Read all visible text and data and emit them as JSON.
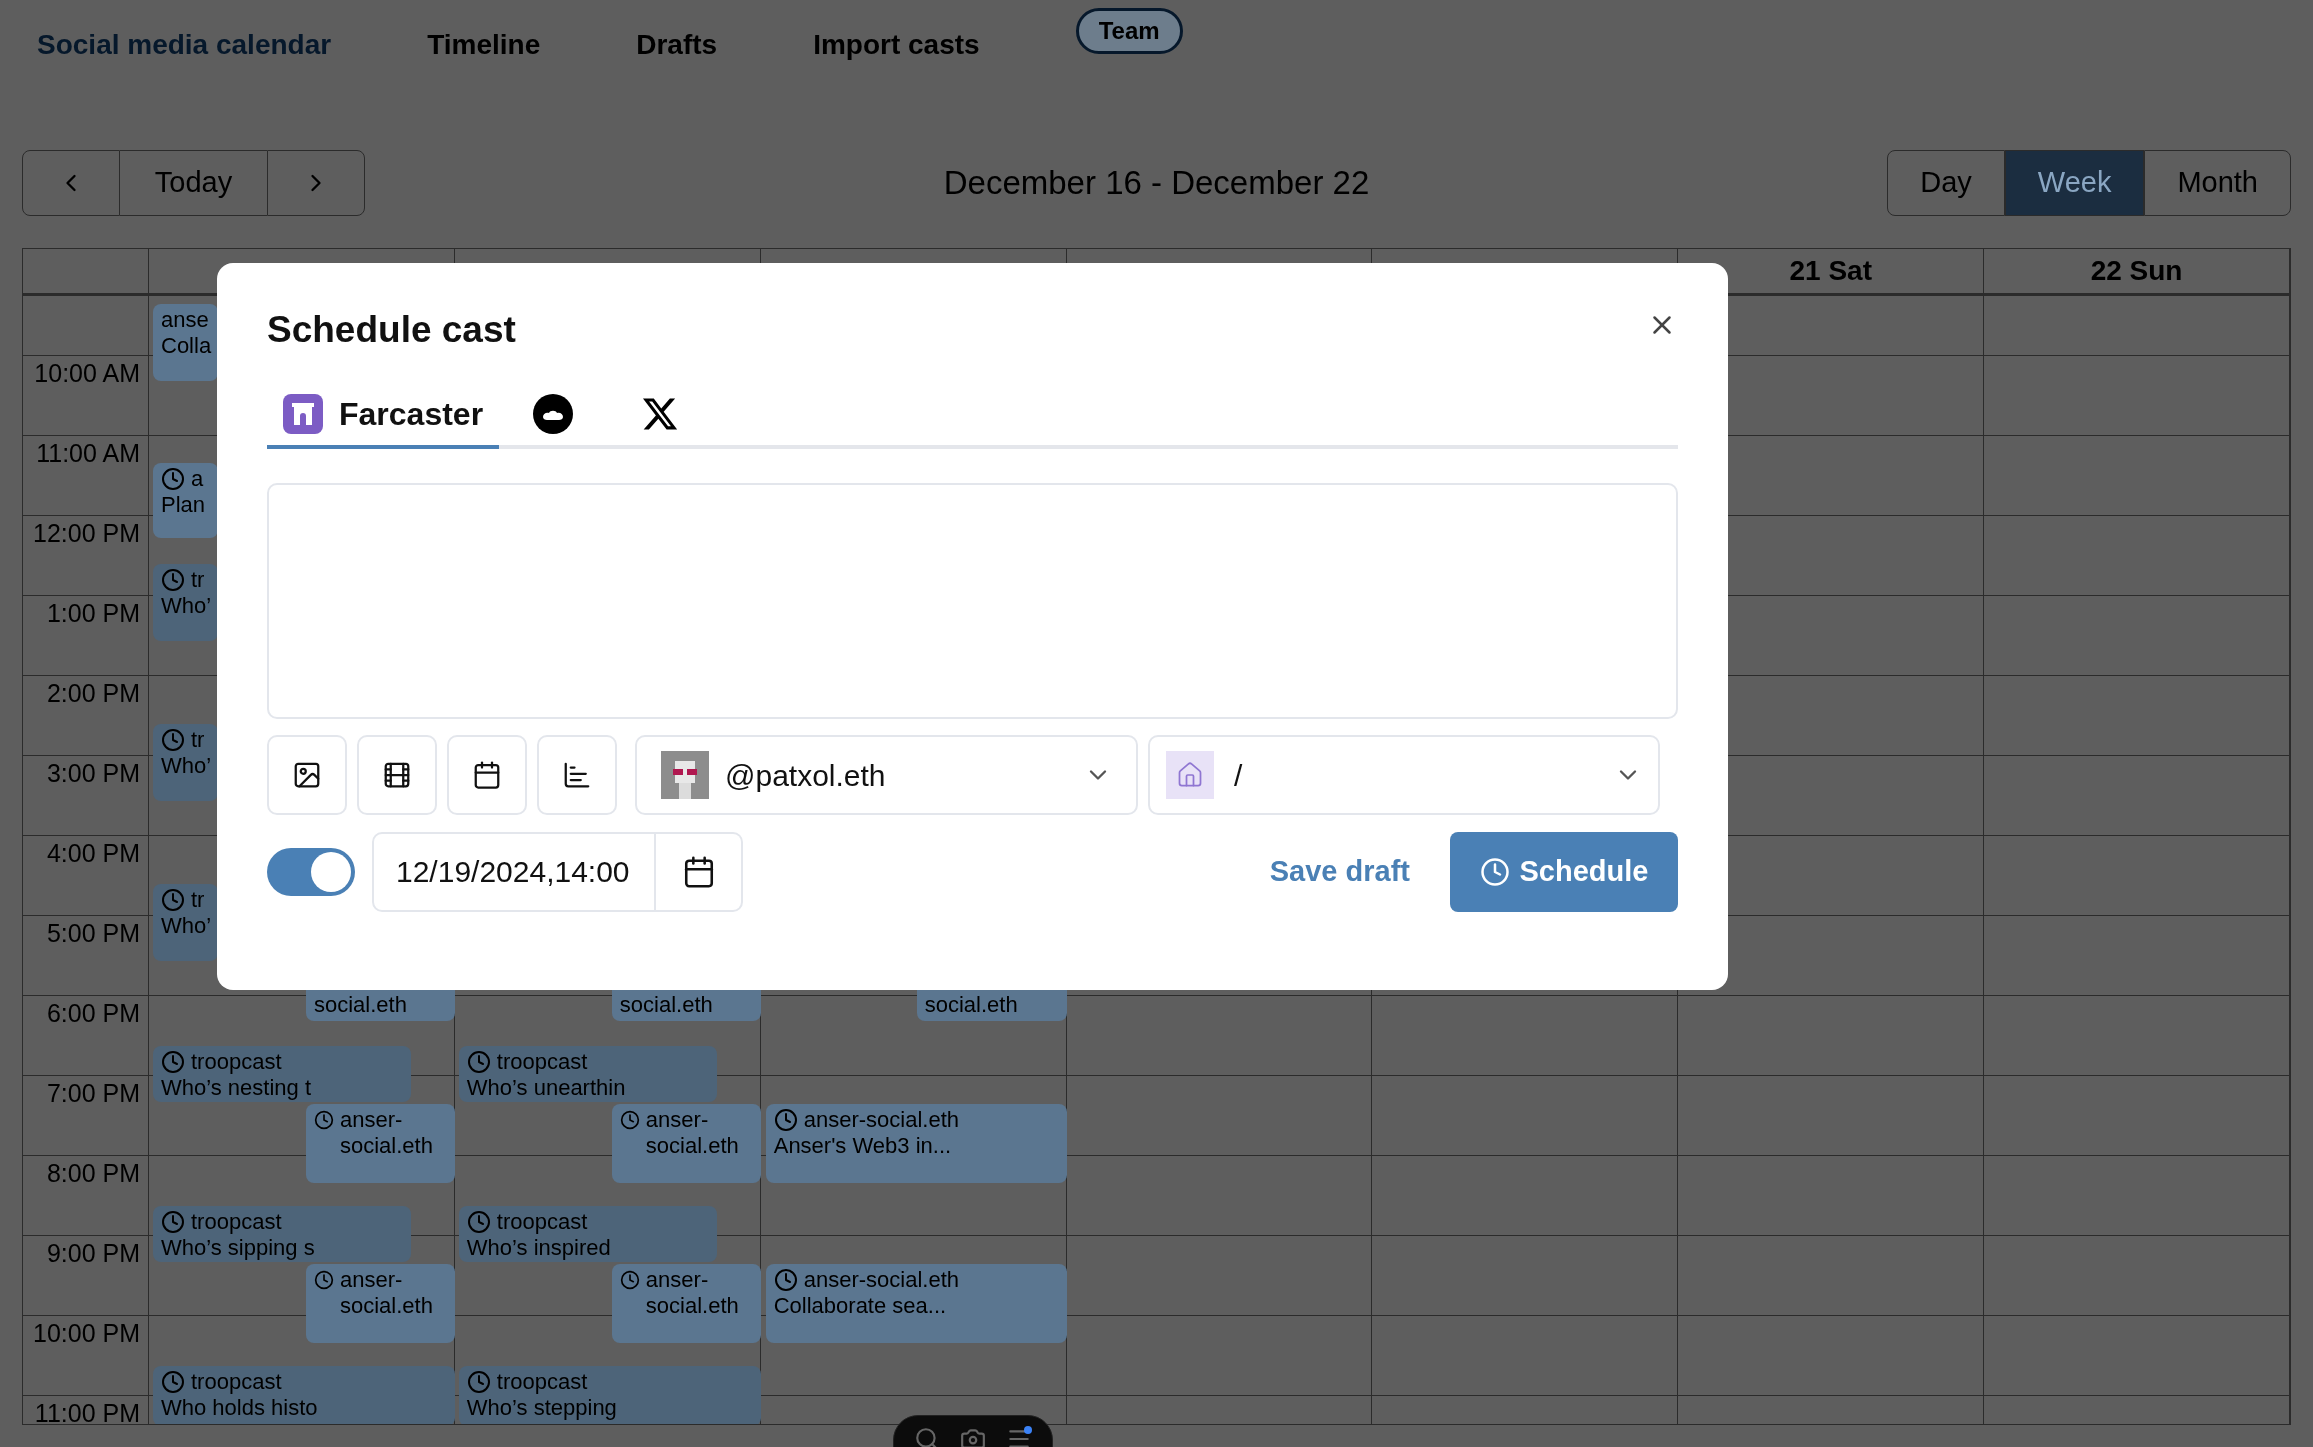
{
  "nav": {
    "items": [
      {
        "label": "Social media calendar",
        "selected": true
      },
      {
        "label": "Timeline",
        "selected": false
      },
      {
        "label": "Drafts",
        "selected": false
      },
      {
        "label": "Import casts",
        "selected": false
      }
    ],
    "badge": "Team"
  },
  "toolbar": {
    "today": "Today",
    "range": "December 16 - December 22",
    "views": [
      {
        "label": "Day",
        "selected": false
      },
      {
        "label": "Week",
        "selected": true
      },
      {
        "label": "Month",
        "selected": false
      }
    ]
  },
  "calendar": {
    "times": [
      "10:00 AM",
      "11:00 AM",
      "12:00 PM",
      "1:00 PM",
      "2:00 PM",
      "3:00 PM",
      "4:00 PM",
      "5:00 PM",
      "6:00 PM",
      "7:00 PM",
      "8:00 PM",
      "9:00 PM",
      "10:00 PM",
      "11:00 PM"
    ],
    "columns": [
      {
        "events": [
          {
            "kind": "muted",
            "icon": false,
            "lines": [
              "anse",
              "Colla"
            ]
          },
          {
            "kind": "muted",
            "icon": true,
            "lines": [
              "a",
              "Plan"
            ]
          },
          {
            "kind": "solid",
            "icon": true,
            "lines": [
              "tr",
              "Who’"
            ]
          },
          {
            "kind": "solid",
            "icon": true,
            "lines": [
              "tr",
              "Who’"
            ]
          },
          {
            "kind": "solid",
            "icon": true,
            "lines": [
              "tr",
              "Who’"
            ]
          },
          {
            "kind": "muted",
            "icon": false,
            "lines": [
              "social.eth"
            ]
          },
          {
            "kind": "solid",
            "icon": true,
            "lines": [
              "troopcast",
              "Who’s nesting t"
            ]
          },
          {
            "kind": "muted",
            "icon": true,
            "lines": [
              "anser-",
              "social.eth"
            ]
          },
          {
            "kind": "solid",
            "icon": true,
            "lines": [
              "troopcast",
              "Who’s sipping s"
            ]
          },
          {
            "kind": "muted",
            "icon": true,
            "lines": [
              "anser-",
              "social.eth"
            ]
          },
          {
            "kind": "solid",
            "icon": true,
            "lines": [
              "troopcast",
              "Who holds histo"
            ]
          }
        ]
      },
      {
        "events": [
          {
            "kind": "muted",
            "icon": false,
            "lines": [
              "social.eth"
            ]
          },
          {
            "kind": "solid",
            "icon": true,
            "lines": [
              "troopcast",
              "Who’s unearthin"
            ]
          },
          {
            "kind": "muted",
            "icon": true,
            "lines": [
              "anser-",
              "social.eth"
            ]
          },
          {
            "kind": "solid",
            "icon": true,
            "lines": [
              "troopcast",
              "Who’s inspired"
            ]
          },
          {
            "kind": "muted",
            "icon": true,
            "lines": [
              "anser-",
              "social.eth"
            ]
          },
          {
            "kind": "solid",
            "icon": true,
            "lines": [
              "troopcast",
              "Who’s stepping"
            ]
          }
        ]
      },
      {
        "events": [
          {
            "kind": "muted",
            "icon": false,
            "lines": [
              "social.eth"
            ]
          },
          {
            "kind": "muted",
            "icon": true,
            "lines": [
              "anser-social.eth",
              "Anser's Web3 in..."
            ]
          },
          {
            "kind": "muted",
            "icon": true,
            "lines": [
              "anser-social.eth",
              "Collaborate sea..."
            ]
          }
        ]
      },
      {},
      {},
      {
        "header": "21 Sat"
      },
      {
        "header": "22 Sun"
      }
    ]
  },
  "dialog": {
    "title": "Schedule cast",
    "tabs": [
      {
        "kind": "farcaster",
        "label": "Farcaster",
        "selected": true
      },
      {
        "kind": "lens",
        "selected": false
      },
      {
        "kind": "x",
        "selected": false
      }
    ],
    "account": "@patxol.eth",
    "channel": "/",
    "schedule_on": true,
    "datetime": "12/19/2024,14:00",
    "save_draft": "Save draft",
    "schedule": "Schedule"
  }
}
